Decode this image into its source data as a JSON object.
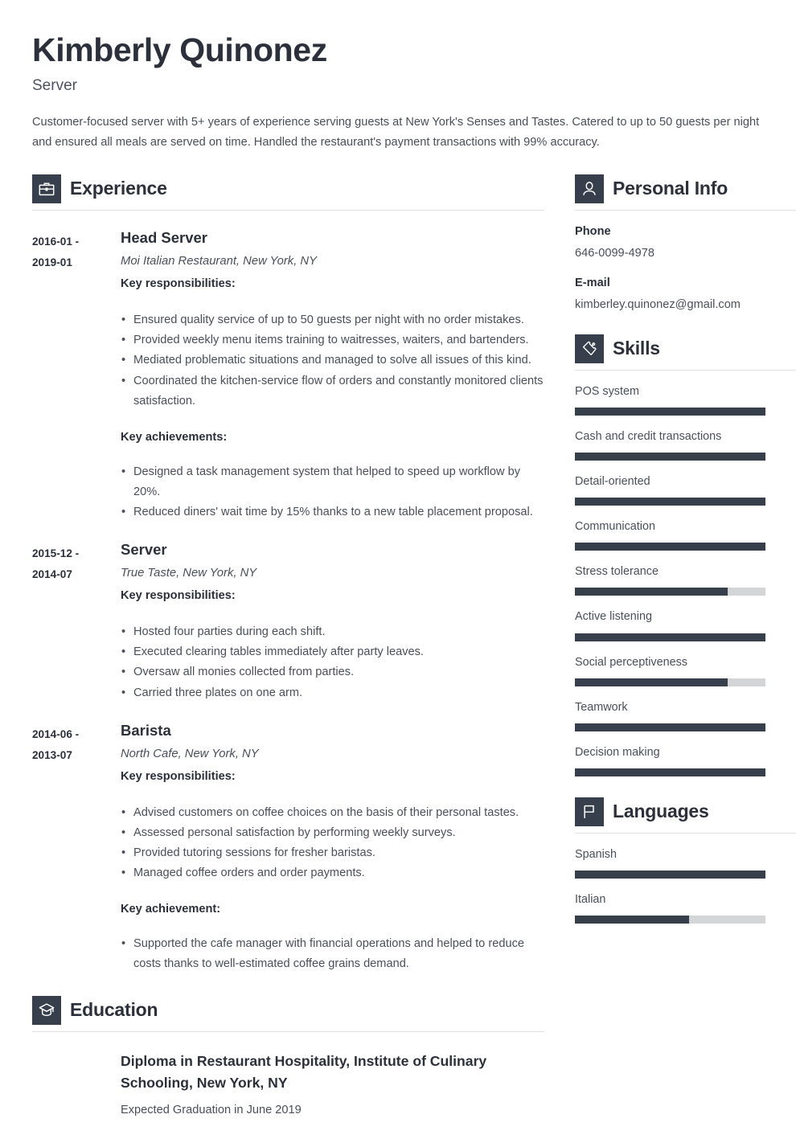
{
  "header": {
    "name": "Kimberly Quinonez",
    "role": "Server",
    "summary": "Customer-focused server with 5+ years of experience serving guests at New York's Senses and Tastes. Catered to up to 50 guests per night and ensured all meals are served on time. Handled the restaurant's payment transactions with 99% accuracy."
  },
  "theme": {
    "accent": "#373f4d",
    "track": "#d3d5d6",
    "text_dark": "#2b303b",
    "text_body": "#4a4f59",
    "rule": "#dfe0e2"
  },
  "experience": {
    "title": "Experience",
    "icon": "briefcase-icon",
    "jobs": [
      {
        "dates": "2016-01 - 2019-01",
        "date_from": "2016-01 -",
        "date_to": "2019-01",
        "title": "Head Server",
        "company": "Moi Italian Restaurant, New York, NY",
        "responsibilities_label": "Key responsibilities:",
        "responsibilities": [
          "Ensured quality service of up to 50 guests per night with no order mistakes.",
          "Provided weekly menu items training to waitresses, waiters, and bartenders.",
          "Mediated problematic situations and managed to solve all issues of this kind.",
          "Coordinated the kitchen-service flow of orders and constantly monitored clients satisfaction."
        ],
        "achievements_label": "Key achievements:",
        "achievements": [
          "Designed a task management system that helped to speed up workflow by 20%.",
          "Reduced diners' wait time by 15% thanks to a new table placement proposal."
        ]
      },
      {
        "dates": "2015-12 - 2014-07",
        "date_from": "2015-12 -",
        "date_to": "2014-07",
        "title": "Server",
        "company": "True Taste, New York, NY",
        "responsibilities_label": "Key responsibilities:",
        "responsibilities": [
          "Hosted four parties during each shift.",
          "Executed clearing tables immediately after party leaves.",
          "Oversaw all monies collected from parties.",
          "Carried three plates on one arm."
        ],
        "achievements_label": "",
        "achievements": []
      },
      {
        "dates": "2014-06 - 2013-07",
        "date_from": "2014-06 -",
        "date_to": "2013-07",
        "title": "Barista",
        "company": "North Cafe, New York, NY",
        "responsibilities_label": "Key responsibilities:",
        "responsibilities": [
          "Advised customers on coffee choices on the basis of their personal tastes.",
          "Assessed personal satisfaction by performing weekly surveys.",
          "Provided tutoring sessions for fresher baristas.",
          "Managed coffee orders and order payments."
        ],
        "achievements_label": "Key achievement:",
        "achievements": [
          "Supported the cafe manager with financial operations and helped to reduce costs thanks to well-estimated coffee grains demand."
        ]
      }
    ]
  },
  "education": {
    "title": "Education",
    "icon": "graduation-cap-icon",
    "entries": [
      {
        "degree": "Diploma in Restaurant Hospitality, Institute of Culinary Schooling, New York, NY",
        "graduation": "Expected Graduation in June 2019"
      }
    ]
  },
  "personal_info": {
    "title": "Personal Info",
    "icon": "person-icon",
    "items": [
      {
        "label": "Phone",
        "value": "646-0099-4978"
      },
      {
        "label": "E-mail",
        "value": "kimberley.quinonez@gmail.com"
      }
    ]
  },
  "skills": {
    "title": "Skills",
    "icon": "puzzle-piece-icon",
    "items": [
      {
        "name": "POS system",
        "level": 100
      },
      {
        "name": "Cash and credit transactions",
        "level": 100
      },
      {
        "name": "Detail-oriented",
        "level": 100
      },
      {
        "name": "Communication",
        "level": 100
      },
      {
        "name": "Stress tolerance",
        "level": 80
      },
      {
        "name": "Active listening",
        "level": 100
      },
      {
        "name": "Social perceptiveness",
        "level": 80
      },
      {
        "name": "Teamwork",
        "level": 100
      },
      {
        "name": "Decision making",
        "level": 100
      }
    ]
  },
  "languages": {
    "title": "Languages",
    "icon": "flag-icon",
    "items": [
      {
        "name": "Spanish",
        "level": 100
      },
      {
        "name": "Italian",
        "level": 60
      }
    ]
  }
}
